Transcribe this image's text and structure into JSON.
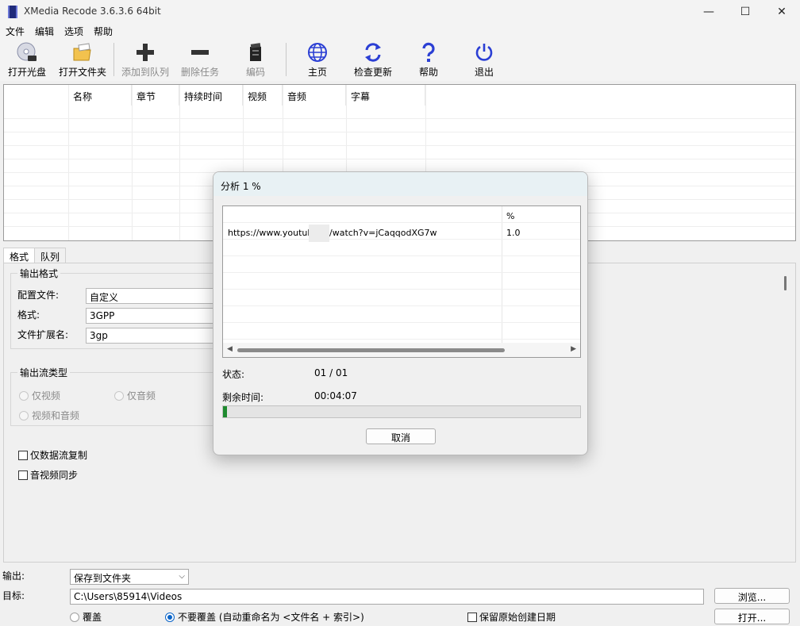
{
  "window": {
    "title": "XMedia Recode 3.6.3.6 64bit",
    "controls": {
      "minimize": "—",
      "maximize": "☐",
      "close": "✕"
    }
  },
  "menu": [
    "文件",
    "编辑",
    "选项",
    "帮助"
  ],
  "toolbar": {
    "open_disc": "打开光盘",
    "open_folder": "打开文件夹",
    "add_queue": "添加到队列",
    "delete_task": "删除任务",
    "encode": "编码",
    "home": "主页",
    "check_update": "检查更新",
    "help": "帮助",
    "exit": "退出",
    "accent_color": "#2b3fd4"
  },
  "file_list": {
    "columns": [
      "名称",
      "章节",
      "持续时间",
      "视频",
      "音频",
      "字幕"
    ]
  },
  "tabs": [
    "格式",
    "队列"
  ],
  "format_panel": {
    "output_format_group": "输出格式",
    "profile_label": "配置文件:",
    "profile_value": "自定义",
    "format_label": "格式:",
    "format_value": "3GPP",
    "ext_label": "文件扩展名:",
    "ext_value": "3gp",
    "stream_group": "输出流类型",
    "video_only": "仅视频",
    "audio_only": "仅音频",
    "video_audio": "视频和音频",
    "stream_copy": "仅数据流复制",
    "av_sync": "音视频同步"
  },
  "bottom": {
    "output_label": "输出:",
    "output_value": "保存到文件夹",
    "target_label": "目标:",
    "target_value": "C:\\Users\\85914\\Videos",
    "browse_button": "浏览...",
    "open_button": "打开...",
    "overwrite": "覆盖",
    "no_overwrite": "不要覆盖 (自动重命名为 <文件名 + 索引>)",
    "keep_date": "保留原始创建日期"
  },
  "dialog": {
    "title": "分析 1 %",
    "col_percent": "%",
    "row_url_a": "https://www.youtub",
    "row_url_b": "/watch?v=jCaqqodXG7w",
    "row_percent": "1.0",
    "status_label": "状态:",
    "status_value": "01 / 01",
    "remaining_label": "剩余时间:",
    "remaining_value": "00:04:07",
    "progress": 0.01,
    "cancel": "取消",
    "progress_color": "#1f8a2f"
  }
}
